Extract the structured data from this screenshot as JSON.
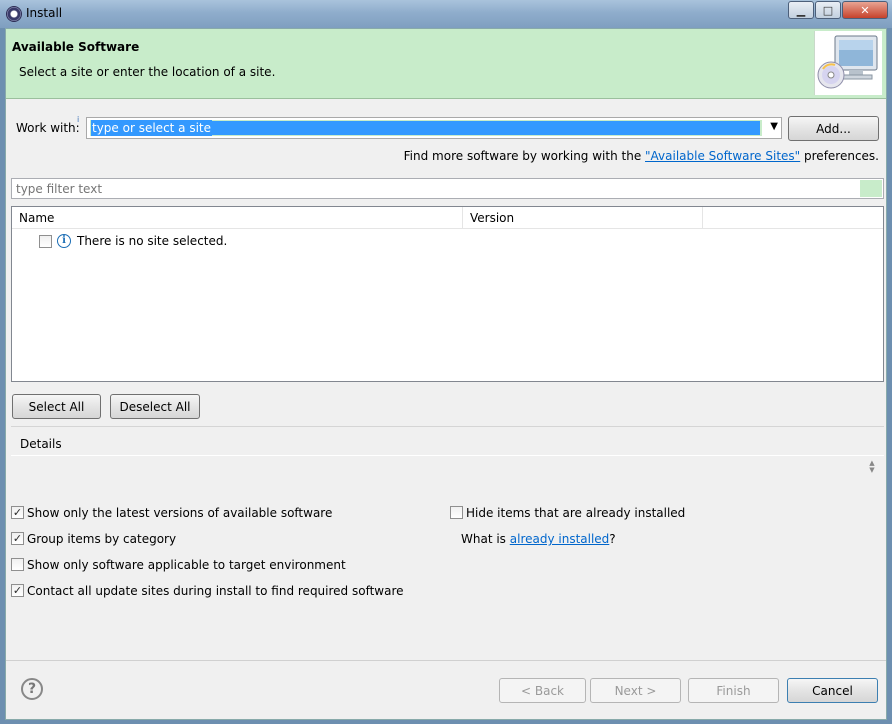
{
  "window": {
    "title": "Install"
  },
  "banner": {
    "title": "Available Software",
    "description": "Select a site or enter the location of a site."
  },
  "work_with": {
    "label": "Work with:",
    "placeholder": "type or select a site",
    "add_label": "Add..."
  },
  "find_more": {
    "prefix": "Find more software by working with the ",
    "link": "\"Available Software Sites\"",
    "suffix": " preferences."
  },
  "filter": {
    "placeholder": "type filter text"
  },
  "table": {
    "columns": [
      "Name",
      "Version"
    ],
    "rows": [
      {
        "name": "There is no site selected.",
        "checked": false
      }
    ]
  },
  "buttons": {
    "select_all": "Select All",
    "deselect_all": "Deselect All",
    "back": "< Back",
    "next": "Next >",
    "finish": "Finish",
    "cancel": "Cancel"
  },
  "details": {
    "label": "Details"
  },
  "options": {
    "show_latest": {
      "label": "Show only the latest versions of available software",
      "checked": true
    },
    "group_by_category": {
      "label": "Group items by category",
      "checked": true
    },
    "show_applicable": {
      "label": "Show only software applicable to target environment",
      "checked": false
    },
    "contact_sites": {
      "label": "Contact all update sites during install to find required software",
      "checked": true
    },
    "hide_installed": {
      "label": "Hide items that are already installed",
      "checked": false
    }
  },
  "what_is": {
    "prefix": "What is ",
    "link": "already installed",
    "suffix": "?"
  },
  "colors": {
    "banner": "#c8ecca",
    "link": "#0066cc",
    "selection": "#3399ff"
  }
}
